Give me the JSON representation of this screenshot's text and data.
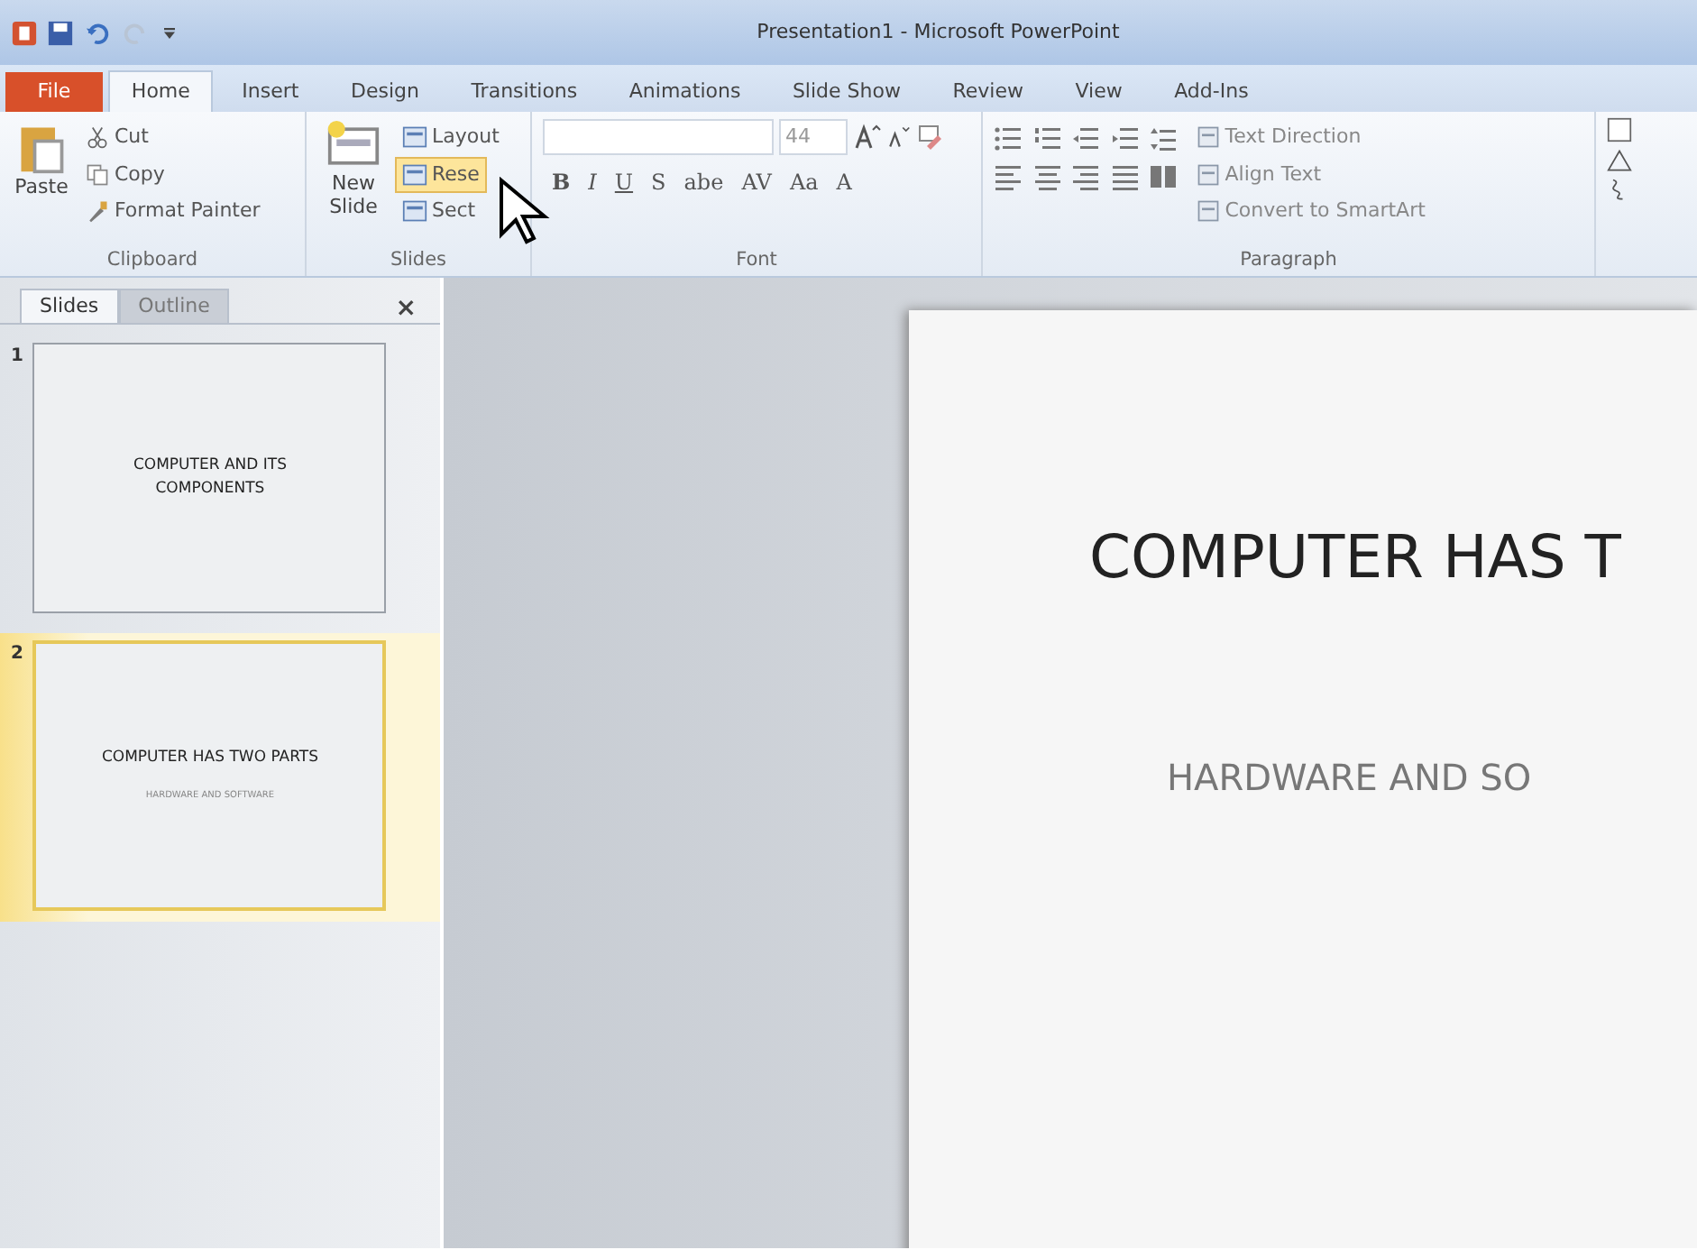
{
  "window": {
    "title": "Presentation1 - Microsoft PowerPoint"
  },
  "file_tab": "File",
  "tabs": [
    {
      "label": "Home",
      "selected": true
    },
    {
      "label": "Insert",
      "selected": false
    },
    {
      "label": "Design",
      "selected": false
    },
    {
      "label": "Transitions",
      "selected": false
    },
    {
      "label": "Animations",
      "selected": false
    },
    {
      "label": "Slide Show",
      "selected": false
    },
    {
      "label": "Review",
      "selected": false
    },
    {
      "label": "View",
      "selected": false
    },
    {
      "label": "Add-Ins",
      "selected": false
    }
  ],
  "clipboard": {
    "label": "Clipboard",
    "paste": "Paste",
    "cut": "Cut",
    "copy": "Copy",
    "format_painter": "Format Painter"
  },
  "slides_group": {
    "label": "Slides",
    "new_slide": "New Slide",
    "items": [
      {
        "label": "Layout",
        "hovered": false
      },
      {
        "label": "Rese",
        "hovered": true
      },
      {
        "label": "Sect",
        "hovered": false
      }
    ]
  },
  "font": {
    "label": "Font",
    "size": "44",
    "buttons": [
      "B",
      "I",
      "U",
      "S",
      "abe",
      "AV",
      "Aa",
      "A"
    ]
  },
  "paragraph": {
    "label": "Paragraph",
    "items": [
      "Text Direction",
      "Align Text",
      "Convert to SmartArt"
    ]
  },
  "pane_tabs": [
    {
      "label": "Slides",
      "selected": true
    },
    {
      "label": "Outline",
      "selected": false
    }
  ],
  "pane_close": "×",
  "thumbnails": [
    {
      "number": "1",
      "title": "COMPUTER AND ITS COMPONENTS",
      "selected": false
    },
    {
      "number": "2",
      "title": "COMPUTER HAS TWO PARTS",
      "subtitle": "HARDWARE AND SOFTWARE",
      "selected": true
    }
  ],
  "slide": {
    "title": "COMPUTER HAS T",
    "subtitle": "HARDWARE AND SO"
  }
}
